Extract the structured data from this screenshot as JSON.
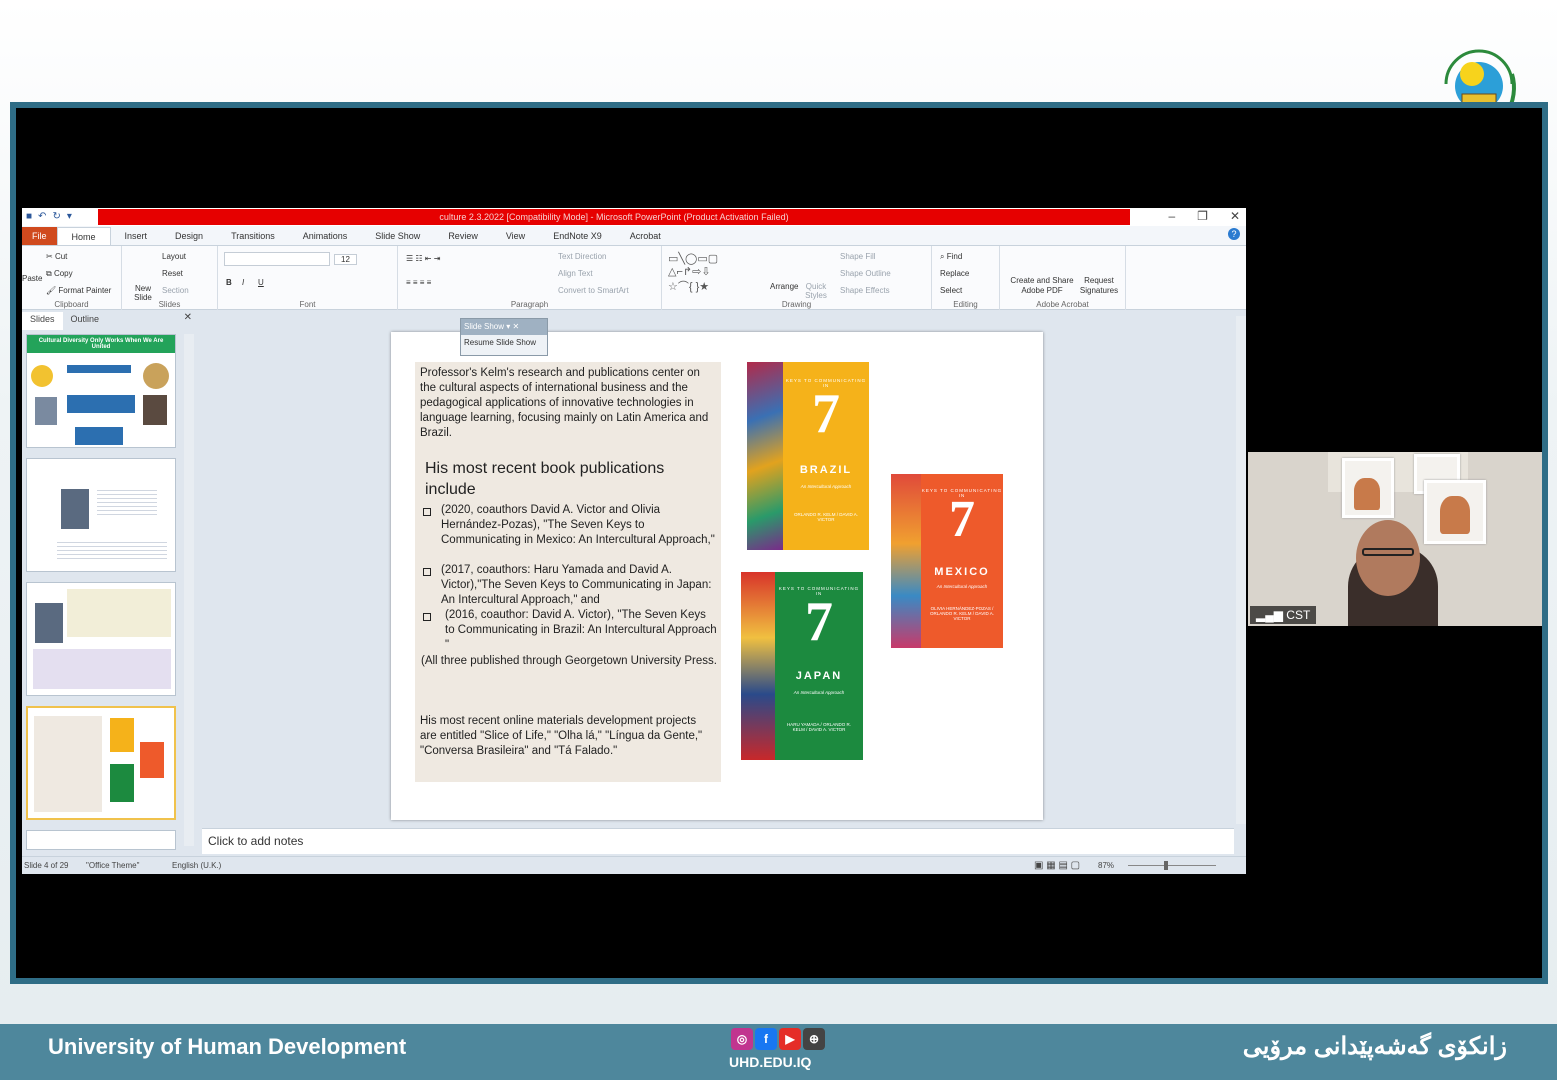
{
  "ppt": {
    "title": "culture 2.3.2022 [Compatibility Mode] - Microsoft PowerPoint (Product Activation Failed)",
    "tabs": [
      "File",
      "Home",
      "Insert",
      "Design",
      "Transitions",
      "Animations",
      "Slide Show",
      "Review",
      "View",
      "EndNote X9",
      "Acrobat"
    ],
    "active_tab": "Home",
    "ribbon": {
      "clipboard": {
        "label": "Clipboard",
        "paste": "Paste",
        "cut": "Cut",
        "copy": "Copy",
        "format_painter": "Format Painter"
      },
      "slides": {
        "label": "Slides",
        "new_slide": "New Slide",
        "layout": "Layout",
        "reset": "Reset",
        "section": "Section"
      },
      "font": {
        "label": "Font",
        "size": "12"
      },
      "paragraph": {
        "label": "Paragraph",
        "text_direction": "Text Direction",
        "align_text": "Align Text",
        "smartart": "Convert to SmartArt"
      },
      "drawing": {
        "label": "Drawing",
        "arrange": "Arrange",
        "quick_styles": "Quick Styles",
        "shape_fill": "Shape Fill",
        "shape_outline": "Shape Outline",
        "shape_effects": "Shape Effects"
      },
      "editing": {
        "label": "Editing",
        "find": "Find",
        "replace": "Replace",
        "select": "Select"
      },
      "acrobat": {
        "label": "Adobe Acrobat",
        "create": "Create and Share Adobe PDF",
        "request": "Request Signatures"
      }
    },
    "panel": {
      "tab_slides": "Slides",
      "tab_outline": "Outline",
      "thumb1_title": "Cultural Diversity Only Works When We Are United"
    },
    "floater": {
      "title": "Slide Show",
      "resume": "Resume Slide Show"
    },
    "notes": "Click to add notes",
    "status": {
      "slide": "Slide 4 of 29",
      "theme": "\"Office Theme\"",
      "language": "English (U.K.)",
      "zoom": "87%"
    }
  },
  "slide": {
    "para1": "Professor's Kelm's research and publications center on the cultural aspects of international business and the pedagogical applications of innovative technologies in language learning, focusing mainly on Latin America and Brazil.",
    "heading": "His most recent book publications include",
    "items": [
      "(2020, coauthors David A. Victor and Olivia Hernández-Pozas), \"The Seven Keys to Communicating in Mexico: An Intercultural Approach,\"",
      " (2017, coauthors: Haru Yamada and David A. Victor),\"The Seven Keys to Communicating in Japan: An Intercultural Approach,\"  and",
      "(2016, coauthor: David A. Victor), \"The Seven Keys to Communicating in Brazil: An Intercultural Approach \""
    ],
    "published": "(All three published through Georgetown University Press.",
    "online": "His most recent online materials development projects are entitled \"Slice of Life,\" \"Olha lá,\" \"Língua da Gente,\" \"Conversa Brasileira\" and \"Tá Falado.\"",
    "books": [
      {
        "country": "BRAZIL",
        "color": "#f5b21a",
        "authors": "ORLANDO R. KELM / DAVID A. VICTOR"
      },
      {
        "country": "MEXICO",
        "color": "#ee5a2b",
        "authors": "OLIVIA HERNÁNDEZ-POZAS / ORLANDO R. KELM / DAVID A. VICTOR"
      },
      {
        "country": "JAPAN",
        "color": "#1c8a3f",
        "authors": "HARU YAMADA / ORLANDO R. KELM / DAVID A. VICTOR"
      }
    ],
    "book_number": "7",
    "book_keys": "KEYS TO COMMUNICATING IN",
    "book_subtitle": "An Intercultural Approach"
  },
  "video": {
    "label": "CST"
  },
  "footer": {
    "english": "University of Human Development",
    "kurdish": "زانكۆی گەشەپێدانی مرۆیی",
    "website": "UHD.EDU.IQ"
  },
  "colors": {
    "accent": "#4e879c",
    "ppt_red": "#e60000",
    "frame": "#2f6d86"
  }
}
